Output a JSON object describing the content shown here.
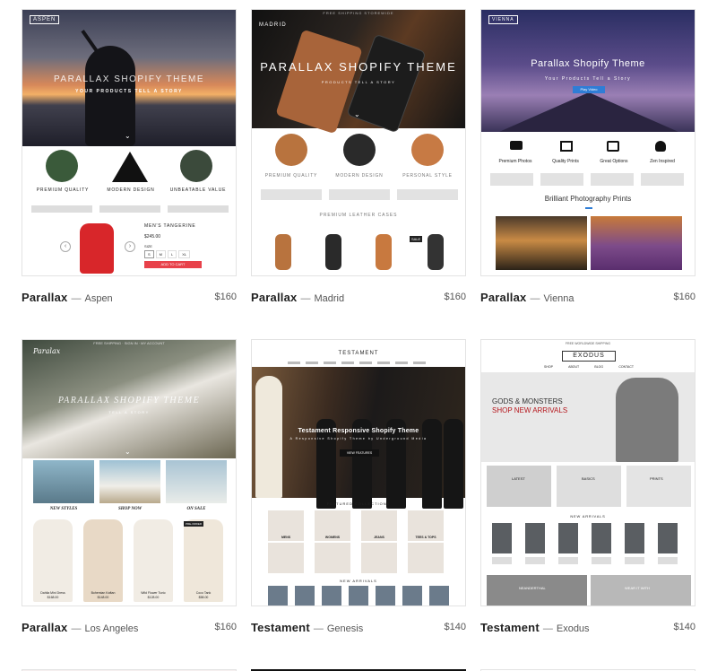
{
  "cards": [
    {
      "name": "Parallax",
      "variant": "Aspen",
      "price": "$160",
      "screenshot": {
        "logo": "ASPEN",
        "hero_title": "PARALLAX SHOPIFY THEME",
        "hero_sub": "YOUR PRODUCTS TELL A STORY",
        "features": [
          "PREMIUM QUALITY",
          "MODERN DESIGN",
          "UNBEATABLE VALUE"
        ],
        "product_name": "MEN'S TANGERINE",
        "product_price": "$245.00",
        "size_label": "SIZE",
        "sizes": [
          "S",
          "M",
          "L",
          "XL"
        ],
        "cta": "ADD TO CART"
      }
    },
    {
      "name": "Parallax",
      "variant": "Madrid",
      "price": "$160",
      "screenshot": {
        "banner": "FREE SHIPPING STOREWIDE",
        "logo": "MADRID",
        "hero_title": "PARALLAX SHOPIFY THEME",
        "hero_sub": "PRODUCTS TELL A STORY",
        "features": [
          "PREMIUM QUALITY",
          "MODERN DESIGN",
          "PERSONAL STYLE"
        ],
        "section": "PREMIUM LEATHER CASES",
        "sale_badge": "SALE"
      }
    },
    {
      "name": "Parallax",
      "variant": "Vienna",
      "price": "$160",
      "screenshot": {
        "logo": "VIENNA",
        "hero_title": "Parallax Shopify Theme",
        "hero_sub": "Your Products Tell a Story",
        "hero_button": "Play Video",
        "features": [
          "Premium Photos",
          "Quality Prints",
          "Great Options",
          "Zen Inspired"
        ],
        "section": "Brilliant Photography Prints"
      }
    },
    {
      "name": "Parallax",
      "variant": "Los Angeles",
      "price": "$160",
      "screenshot": {
        "banner": "FREE SHIPPING · SIGN IN · MY ACCOUNT",
        "logo": "Paralax",
        "hero_title": "PARALLAX SHOPIFY THEME",
        "hero_sub": "TELL A STORY",
        "categories": [
          "NEW STYLES",
          "SHOP NOW",
          "ON SALE"
        ],
        "products": [
          {
            "name": "Dahlia Mini Dress",
            "price": "$168.00"
          },
          {
            "name": "Bohemian Kaftan",
            "price": "$148.00"
          },
          {
            "name": "Wild Flower Tunic",
            "price": "$128.00"
          },
          {
            "name": "Coco Tank",
            "price": "$58.00"
          }
        ],
        "badge": "PRE-ORDER"
      }
    },
    {
      "name": "Testament",
      "variant": "Genesis",
      "price": "$140",
      "screenshot": {
        "logo": "TESTAMENT",
        "hero_title": "Testament Responsive Shopify Theme",
        "hero_sub": "A Responsive Shopify Theme by Underground Media",
        "hero_button": "VIEW FEATURES",
        "section": "FEATURED COLLECTIONS",
        "collections": [
          "MENS",
          "WOMENS",
          "JEANS",
          "TEES & TOPS"
        ],
        "new_section": "NEW ARRIVALS"
      }
    },
    {
      "name": "Testament",
      "variant": "Exodus",
      "price": "$140",
      "screenshot": {
        "banner": "FREE WORLDWIDE SHIPPING",
        "logo": "EXODUS",
        "nav": [
          "SHOP",
          "ABOUT",
          "BLOG",
          "CONTACT"
        ],
        "hero_title": "GODS & MONSTERS",
        "hero_sub": "SHOP NEW ARRIVALS",
        "categories": [
          "LATEST",
          "BASICS",
          "PRINTS"
        ],
        "section": "NEW ARRIVALS",
        "bottom": [
          "NEANDERTHAL",
          "WEAR IT WITH"
        ]
      }
    }
  ],
  "colors": {
    "aspen_cta": "#e8414a",
    "vienna_button": "#2f7dd6",
    "exodus_red": "#b5161c",
    "la_badge": "#222222"
  }
}
